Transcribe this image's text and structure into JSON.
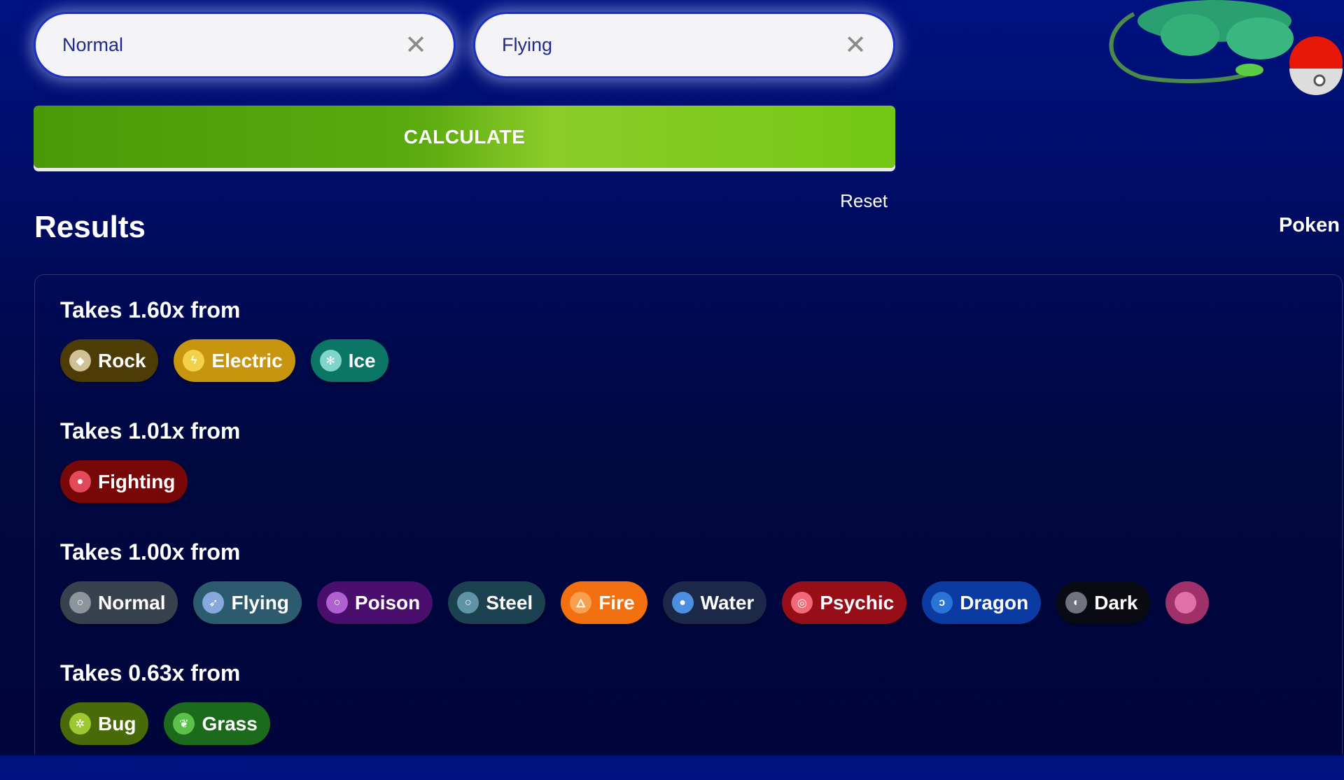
{
  "inputs": [
    {
      "value": "Normal"
    },
    {
      "value": "Flying"
    }
  ],
  "calculate_label": "CALCULATE",
  "reset_label": "Reset",
  "results_title": "Results",
  "side_title": "Poken",
  "sections": [
    {
      "heading": "Takes 1.60x from",
      "types": [
        {
          "name": "Rock",
          "bg": "#4e3c06",
          "ic": "#cfc096",
          "icon": "rock-icon",
          "g": "◆"
        },
        {
          "name": "Electric",
          "bg": "#c8960e",
          "ic": "#f2d24a",
          "icon": "lightning-icon",
          "g": "ϟ"
        },
        {
          "name": "Ice",
          "bg": "#0b7666",
          "ic": "#7fd4cc",
          "icon": "snowflake-icon",
          "g": "✻"
        }
      ]
    },
    {
      "heading": "Takes 1.01x from",
      "types": [
        {
          "name": "Fighting",
          "bg": "#780808",
          "ic": "#e04a5a",
          "icon": "fist-icon",
          "g": "●"
        }
      ]
    },
    {
      "heading": "Takes 1.00x from",
      "types": [
        {
          "name": "Normal",
          "bg": "#38424e",
          "ic": "#8e949c",
          "icon": "circle-icon",
          "g": "○"
        },
        {
          "name": "Flying",
          "bg": "#2c5a6e",
          "ic": "#86a8dc",
          "icon": "wing-icon",
          "g": "➶"
        },
        {
          "name": "Poison",
          "bg": "#4a0e6c",
          "ic": "#b060d0",
          "icon": "poison-icon",
          "g": "○"
        },
        {
          "name": "Steel",
          "bg": "#1c4252",
          "ic": "#5e94a6",
          "icon": "steel-icon",
          "g": "○"
        },
        {
          "name": "Fire",
          "bg": "#f27010",
          "ic": "#f8a050",
          "icon": "flame-icon",
          "g": "🜂"
        },
        {
          "name": "Water",
          "bg": "#1c2848",
          "ic": "#4c8ee0",
          "icon": "droplet-icon",
          "g": "●"
        },
        {
          "name": "Psychic",
          "bg": "#980e18",
          "ic": "#f06a7a",
          "icon": "psychic-icon",
          "g": "◎"
        },
        {
          "name": "Dragon",
          "bg": "#0b3aa2",
          "ic": "#2a74d8",
          "icon": "dragon-icon",
          "g": "ↄ"
        },
        {
          "name": "Dark",
          "bg": "#0a0a12",
          "ic": "#70737e",
          "icon": "moon-icon",
          "g": "◐"
        },
        {
          "name": "",
          "bg": "#a0306a",
          "ic": "#e070a8",
          "icon": "fairy-icon",
          "g": ""
        }
      ]
    },
    {
      "heading": "Takes 0.63x from",
      "types": [
        {
          "name": "Bug",
          "bg": "#486a08",
          "ic": "#9cc830",
          "icon": "bug-icon",
          "g": "✲"
        },
        {
          "name": "Grass",
          "bg": "#1c6a1c",
          "ic": "#5cc04a",
          "icon": "leaf-icon",
          "g": "❦"
        }
      ]
    }
  ]
}
